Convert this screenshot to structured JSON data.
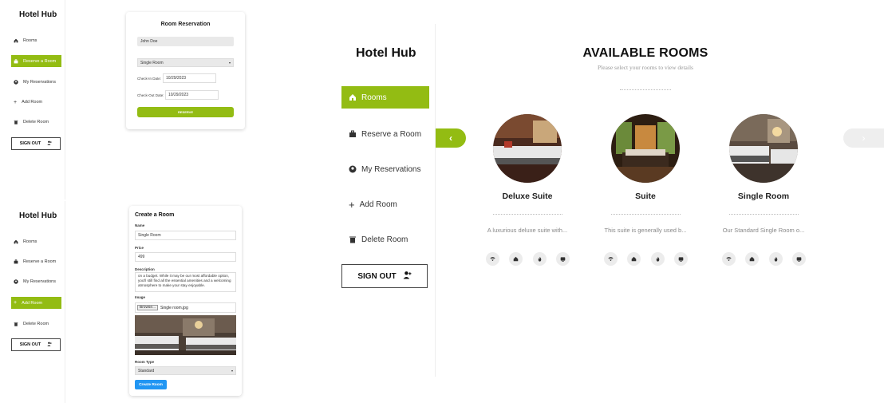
{
  "app": {
    "name": "Hotel Hub"
  },
  "nav": {
    "rooms": "Rooms",
    "reserve": "Reserve a Room",
    "my_reservations": "My Reservations",
    "add_room": "Add Room",
    "delete_room": "Delete Room",
    "sign_out": "SIGN OUT"
  },
  "reservation_form": {
    "title": "Room Reservation",
    "name_value": "John Doe",
    "room_select": "Single Room",
    "checkin_label": "Check-In Date:",
    "checkin_value": "10/29/2023",
    "checkout_label": "Check-Out Date:",
    "checkout_value": "10/29/2023",
    "submit": "RESERVE"
  },
  "create_room_form": {
    "title": "Create a Room",
    "name_label": "Name",
    "name_value": "Single Room",
    "price_label": "Price",
    "price_value": "499",
    "description_label": "Description",
    "description_value": "on a budget. While it may be our most affordable option, you'll still find all the essential amenities and a welcoming atmosphere to make your stay enjoyable.",
    "image_label": "Image",
    "browse_button": "Browse...",
    "file_name": "Single room.jpg",
    "room_type_label": "Room Type",
    "room_type_value": "Standard",
    "submit": "Create Room"
  },
  "rooms_page": {
    "title": "AVAILABLE ROOMS",
    "subtitle": "Please select your rooms to view details",
    "prev_arrow": "‹",
    "next_arrow": "›",
    "rooms": [
      {
        "name": "Deluxe Suite",
        "description": "A luxurious deluxe suite with..."
      },
      {
        "name": "Suite",
        "description": "This suite is generally used b..."
      },
      {
        "name": "Single Room",
        "description": "Our Standard Single Room o..."
      }
    ],
    "amenity_icons": [
      "wifi-icon",
      "home-icon",
      "fire-icon",
      "tv-icon"
    ]
  },
  "colors": {
    "accent": "#93bc13",
    "primary_button": "#2196f3"
  }
}
